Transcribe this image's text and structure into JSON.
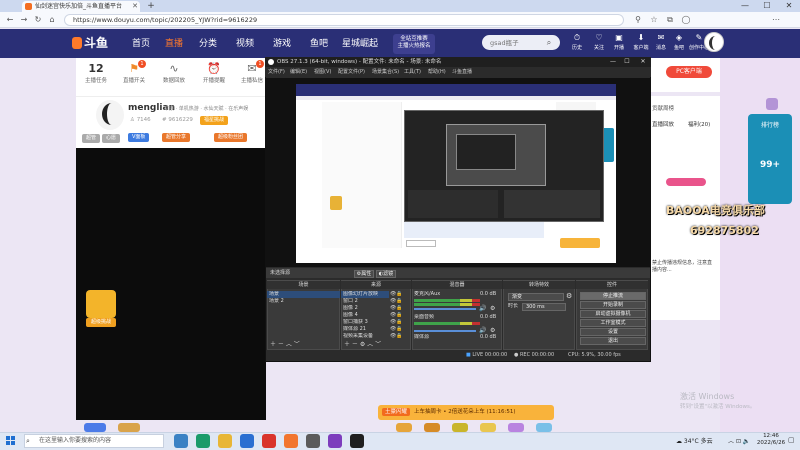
{
  "browser": {
    "tab_title": "仙剑迷宫快乐加倍_斗鱼直播平台",
    "url": "https://www.douyu.com/topic/202205_YJW?rid=9616229",
    "win_min": "—",
    "win_max": "☐",
    "win_close": "✕"
  },
  "header": {
    "logo": "斗鱼",
    "nav": [
      "首页",
      "直播",
      "分类",
      "视频",
      "游戏",
      "鱼吧",
      "星城崛起"
    ],
    "ad_line1": "全站互推赛",
    "ad_line2": "主播火热报名",
    "search_placeholder": "gsad瓶子",
    "icons": [
      {
        "label": "历史",
        "glyph": "⏱"
      },
      {
        "label": "关注",
        "glyph": "♡"
      },
      {
        "label": "开播",
        "glyph": "▣"
      },
      {
        "label": "客户端",
        "glyph": "⬇"
      },
      {
        "label": "消息",
        "glyph": "✉"
      },
      {
        "label": "鱼吧",
        "glyph": "◈"
      },
      {
        "label": "创作中心",
        "glyph": "✎"
      }
    ]
  },
  "room": {
    "stats": [
      {
        "value": "12",
        "label": "主播任务"
      },
      {
        "value": "⚑",
        "label": "直播开关"
      },
      {
        "value": "∿",
        "label": "数据回放"
      },
      {
        "value": "⏰",
        "label": "开播提醒"
      },
      {
        "value": "✉",
        "label": "主播私信"
      }
    ],
    "anchor_name": "menglian",
    "anchor_meta": "举报 · 单机热游 · 水仙天赋 · 在乐声娱",
    "fans": "7146",
    "room_id": "9616229",
    "tags": [
      "超管",
      "心愿",
      "V面板",
      "福星挑战",
      "超管分享",
      "超级粉丝团"
    ]
  },
  "left_gift": {
    "label": "超级挑战"
  },
  "obs": {
    "title": "OBS 27.1.3 (64-bit, windows) - 配置文件: 未命名 - 场景: 未命名",
    "menu": [
      "文件(F)",
      "编辑(E)",
      "视图(V)",
      "配置文件(P)",
      "场景集合(S)",
      "工具(T)",
      "帮助(H)",
      "斗鱼直播"
    ],
    "no_source": "未选择源",
    "props_btn": "属性",
    "filter_btn": "滤镜",
    "docks": {
      "scenes": {
        "title": "场景",
        "items": [
          "场景",
          "场景 2"
        ]
      },
      "sources": {
        "title": "来源",
        "items": [
          "图像幻灯片放映",
          "窗口 2",
          "图像 2",
          "图像 4",
          "窗口捕获 3",
          "媒体源 21",
          "视频采集设备"
        ]
      },
      "mixer": {
        "title": "混音器",
        "tracks": [
          {
            "name": "麦克风/Aux",
            "db": "0.0 dB"
          },
          {
            "name": "桌面音频",
            "db": "0.0 dB"
          },
          {
            "name": "媒体源",
            "db": "0.0 dB"
          }
        ]
      },
      "transitions": {
        "title": "转场特效",
        "type": "渐变",
        "duration_label": "时长",
        "duration": "300 ms"
      },
      "controls": {
        "title": "控件",
        "buttons": [
          "停止推流",
          "开始录制",
          "启动虚拟摄像机",
          "工作室模式",
          "设置",
          "退出"
        ]
      }
    },
    "status": {
      "live": "LIVE",
      "live_time": "00:00:00",
      "rec": "REC",
      "rec_time": "00:00:00",
      "cpu": "CPU: 5.9%, 30.00 fps"
    }
  },
  "right": {
    "pc_client": "PC客户端",
    "tabs": [
      "直播回放",
      "福利(20)"
    ],
    "list_label": "贡献周榜",
    "rank_caption": "排行榜",
    "rank_rank": "99+",
    "chat_text": "禁止传播违规信息，注意直播内容...",
    "overlay_team": "BAOOA电竞俱乐部",
    "overlay_id": "692875802"
  },
  "banner": {
    "tag": "土豪闪耀",
    "text": "上车抽周卡 • 2倍送花朵上车 (11:16:51)"
  },
  "watermark": {
    "line1": "激活 Windows",
    "line2": "转到\"设置\"以激活 Windows。"
  },
  "taskbar": {
    "search": "在这里输入你要搜索的内容",
    "weather": "34°C 多云",
    "time": "12:46",
    "date": "2022/6/26",
    "apps": [
      {
        "color": "#3b82c4"
      },
      {
        "color": "#1a9b6a"
      },
      {
        "color": "#e8b636"
      },
      {
        "color": "#2a6fd1"
      },
      {
        "color": "#d9342b"
      },
      {
        "color": "#f2762e"
      },
      {
        "color": "#5b5b5b"
      },
      {
        "color": "#7d3dbd"
      },
      {
        "color": "#1f1f1f"
      }
    ]
  }
}
